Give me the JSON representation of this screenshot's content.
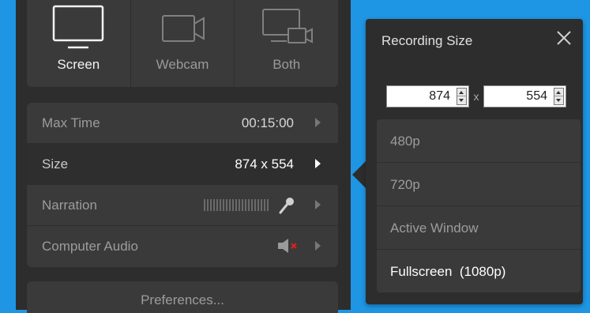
{
  "modes": [
    {
      "label": "Screen",
      "icon": "monitor-icon"
    },
    {
      "label": "Webcam",
      "icon": "webcam-icon"
    },
    {
      "label": "Both",
      "icon": "screen-and-webcam-icon"
    }
  ],
  "settings": {
    "max_time": {
      "label": "Max Time",
      "value": "00:15:00"
    },
    "size": {
      "label": "Size",
      "value": "874 x 554"
    },
    "narration": {
      "label": "Narration",
      "icon": "microphone-icon"
    },
    "computer_audio": {
      "label": "Computer Audio",
      "icon": "speaker-muted-icon"
    }
  },
  "preferences_label": "Preferences...",
  "popup": {
    "title": "Recording Size",
    "width": "874",
    "height": "554",
    "times": "x",
    "options": [
      "480p",
      "720p",
      "Active Window",
      "Fullscreen  (1080p)"
    ],
    "selected": "Fullscreen  (1080p)"
  },
  "colors": {
    "background": "#1e96e4",
    "panel": "#2d2d2d",
    "row": "#3a3a3a",
    "mute_mark": "#e02020"
  }
}
